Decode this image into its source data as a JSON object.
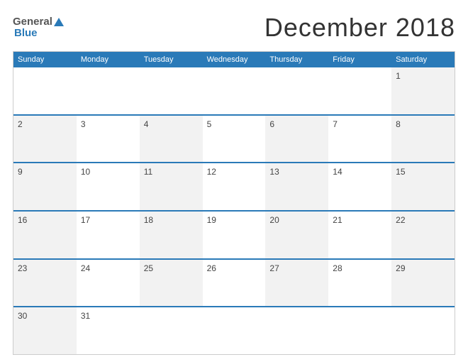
{
  "header": {
    "logo": {
      "general": "General",
      "blue": "Blue",
      "line1": "General",
      "line2": "Blue"
    },
    "title": "December 2018"
  },
  "calendar": {
    "dayHeaders": [
      "Sunday",
      "Monday",
      "Tuesday",
      "Wednesday",
      "Thursday",
      "Friday",
      "Saturday"
    ],
    "weeks": [
      [
        {
          "day": "",
          "empty": true
        },
        {
          "day": "",
          "empty": true
        },
        {
          "day": "",
          "empty": true
        },
        {
          "day": "",
          "empty": true
        },
        {
          "day": "",
          "empty": true
        },
        {
          "day": "",
          "empty": true
        },
        {
          "day": "1",
          "empty": false
        }
      ],
      [
        {
          "day": "2",
          "empty": false
        },
        {
          "day": "3",
          "empty": false
        },
        {
          "day": "4",
          "empty": false
        },
        {
          "day": "5",
          "empty": false
        },
        {
          "day": "6",
          "empty": false
        },
        {
          "day": "7",
          "empty": false
        },
        {
          "day": "8",
          "empty": false
        }
      ],
      [
        {
          "day": "9",
          "empty": false
        },
        {
          "day": "10",
          "empty": false
        },
        {
          "day": "11",
          "empty": false
        },
        {
          "day": "12",
          "empty": false
        },
        {
          "day": "13",
          "empty": false
        },
        {
          "day": "14",
          "empty": false
        },
        {
          "day": "15",
          "empty": false
        }
      ],
      [
        {
          "day": "16",
          "empty": false
        },
        {
          "day": "17",
          "empty": false
        },
        {
          "day": "18",
          "empty": false
        },
        {
          "day": "19",
          "empty": false
        },
        {
          "day": "20",
          "empty": false
        },
        {
          "day": "21",
          "empty": false
        },
        {
          "day": "22",
          "empty": false
        }
      ],
      [
        {
          "day": "23",
          "empty": false
        },
        {
          "day": "24",
          "empty": false
        },
        {
          "day": "25",
          "empty": false
        },
        {
          "day": "26",
          "empty": false
        },
        {
          "day": "27",
          "empty": false
        },
        {
          "day": "28",
          "empty": false
        },
        {
          "day": "29",
          "empty": false
        }
      ],
      [
        {
          "day": "30",
          "empty": false
        },
        {
          "day": "31",
          "empty": false
        },
        {
          "day": "",
          "empty": true
        },
        {
          "day": "",
          "empty": true
        },
        {
          "day": "",
          "empty": true
        },
        {
          "day": "",
          "empty": true
        },
        {
          "day": "",
          "empty": true
        }
      ]
    ]
  }
}
